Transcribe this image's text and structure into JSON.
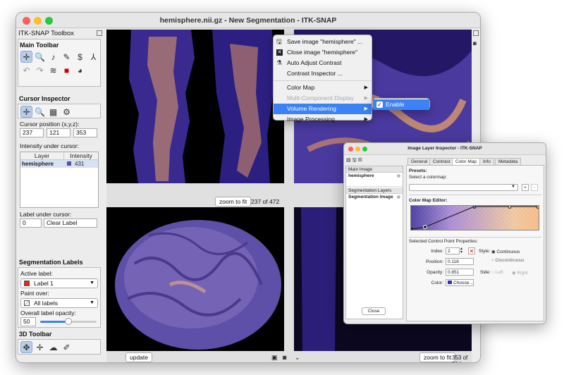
{
  "window": {
    "title": "hemisphere.nii.gz - New Segmentation - ITK-SNAP"
  },
  "toolbox": {
    "title": "ITK-SNAP Toolbox",
    "main_toolbar": {
      "heading": "Main Toolbar"
    },
    "cursor_inspector": {
      "heading": "Cursor Inspector",
      "position_label": "Cursor position (x,y,z):",
      "x": "237",
      "y": "121",
      "z": "353",
      "intensity_label": "Intensity under cursor:",
      "col_layer": "Layer",
      "col_intensity": "Intensity",
      "row_layer": "hemisphere",
      "row_value": "431",
      "label_under_cursor": "Label under cursor:",
      "label_id": "0",
      "label_name": "Clear Label"
    },
    "seg_labels": {
      "heading": "Segmentation Labels",
      "active_label_caption": "Active label:",
      "active_label": "Label 1",
      "active_color": "#e8261b",
      "paint_over_caption": "Paint over:",
      "paint_over": "All labels",
      "opacity_caption": "Overall label opacity:",
      "opacity_value": "50",
      "opacity_fraction": 0.5
    },
    "toolbar3d": {
      "heading": "3D Toolbar"
    }
  },
  "views": {
    "zoom_label": "zoom to fit",
    "top_left_slice": "237 of 472",
    "bottom_right_slice": "353 of 704",
    "update_label": "update"
  },
  "context_menu": {
    "save": "Save image \"hemisphere\" ...",
    "close": "Close image \"hemisphere\"",
    "auto_contrast": "Auto Adjust Contrast",
    "contrast_inspector": "Contrast Inspector ...",
    "color_map": "Color Map",
    "multi_component": "Multi-Component Display",
    "volume_rendering": "Volume Rendering",
    "image_processing": "Image Processing",
    "submenu_enable": "Enable"
  },
  "inspector": {
    "title": "Image Layer Inspector - ITK-SNAP",
    "tabs": [
      "General",
      "Contrast",
      "Color Map",
      "Info",
      "Metadata"
    ],
    "active_tab": 2,
    "left": {
      "main_header": "Main Image",
      "main_item": "hemisphere",
      "seg_header": "Segmentation Layers",
      "seg_item": "Segmentation Image",
      "close_label": "Close"
    },
    "presets_heading": "Presets:",
    "select_colormap": "Select a colormap:",
    "editor_heading": "Color Map Editor:",
    "cp_heading": "Selected Control Point Properties:",
    "index_label": "Index:",
    "index_value": "2",
    "position_label": "Position:",
    "position_value": "0.118",
    "opacity_label": "Opacity:",
    "opacity_value": "0.851",
    "color_label": "Color:",
    "color_button": "Choose...",
    "style_label": "Style:",
    "style_continuous": "Continuous",
    "style_discontinuous": "Discontinuous",
    "side_label": "Side:",
    "side_left": "Left",
    "side_right": "Right"
  }
}
